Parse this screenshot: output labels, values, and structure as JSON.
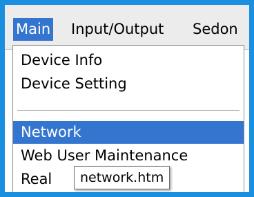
{
  "menubar": {
    "items": [
      {
        "label": "Main",
        "active": true
      },
      {
        "label": "Input/Output",
        "active": false
      },
      {
        "label": "Sedon",
        "active": false
      }
    ]
  },
  "dropdown": {
    "items": [
      {
        "label": "Device Info"
      },
      {
        "label": "Device Setting"
      },
      {
        "label": "Network",
        "selected": true
      },
      {
        "label": "Web User Maintenance"
      },
      {
        "label": "Real"
      }
    ]
  },
  "tooltip": {
    "text": "network.htm"
  },
  "colors": {
    "frame_border": "#1a8fe0",
    "highlight": "#3475d0",
    "menubar_bg": "#ececec"
  }
}
